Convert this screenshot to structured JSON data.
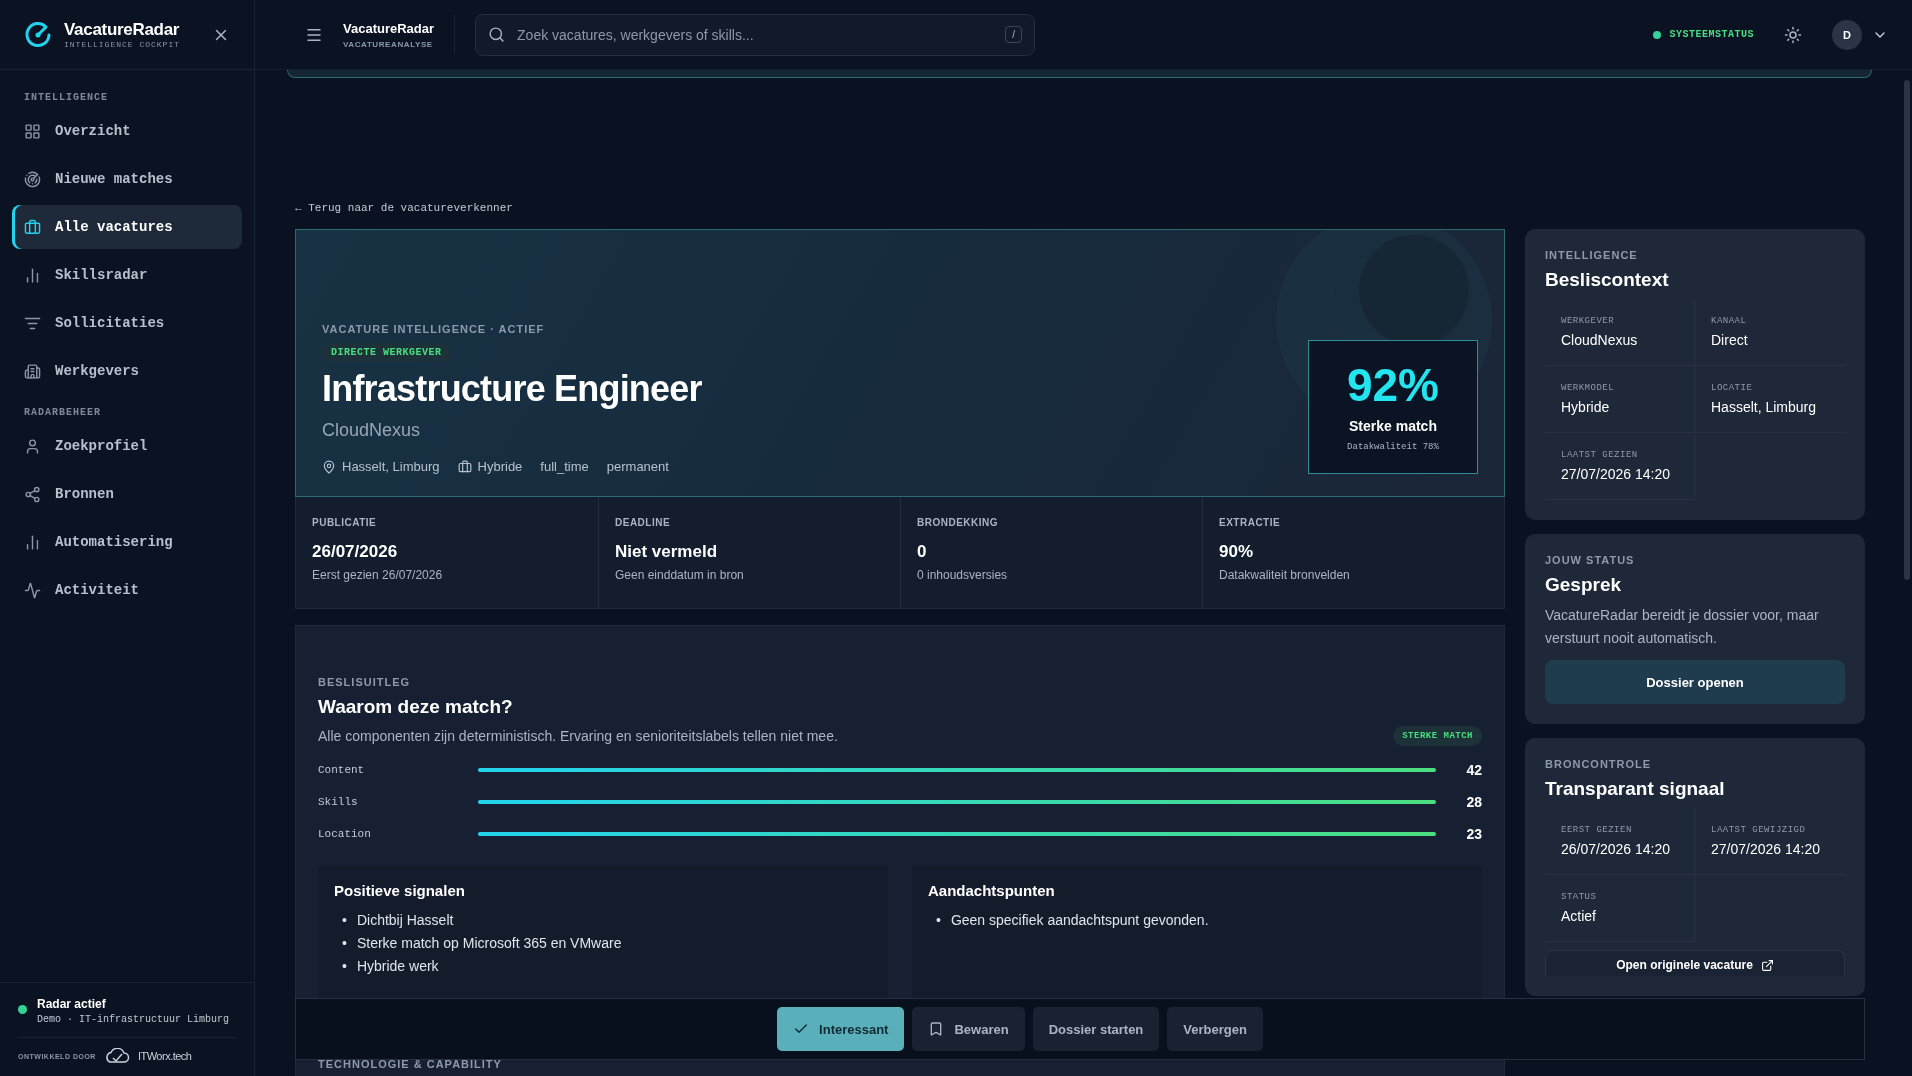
{
  "sidebar": {
    "brand": {
      "name": "VacatureRadar",
      "subtitle": "INTELLIGENCE COCKPIT"
    },
    "sections": [
      {
        "title": "INTELLIGENCE",
        "items": [
          {
            "label": "Overzicht",
            "selected": false
          },
          {
            "label": "Nieuwe matches",
            "selected": false
          },
          {
            "label": "Alle vacatures",
            "selected": true
          },
          {
            "label": "Skillsradar",
            "selected": false
          },
          {
            "label": "Sollicitaties",
            "selected": false
          },
          {
            "label": "Werkgevers",
            "selected": false
          }
        ]
      },
      {
        "title": "RADARBEHEER",
        "items": [
          {
            "label": "Zoekprofiel",
            "selected": false
          },
          {
            "label": "Bronnen",
            "selected": false
          },
          {
            "label": "Automatisering",
            "selected": false
          },
          {
            "label": "Activiteit",
            "selected": false
          }
        ]
      }
    ],
    "footer": {
      "status_title": "Radar actief",
      "status_detail": "Demo · IT-infrastructuur Limburg",
      "credit_label": "ONTWIKKELD DOOR",
      "credit_name": "ITWorx.tech"
    }
  },
  "topbar": {
    "title": "VacatureRadar",
    "subtitle": "VACATUREANALYSE",
    "search": {
      "placeholder": "Zoek vacatures, werkgevers of skills...",
      "shortcut": "/"
    },
    "status": "SYSTEEMSTATUS",
    "avatar": "D"
  },
  "back_link": "← Terug naar de vacatureverkenner",
  "hero": {
    "eyebrow": "VACATURE INTELLIGENCE · ACTIEF",
    "badge": "DIRECTE WERKGEVER",
    "title": "Infrastructure Engineer",
    "company": "CloudNexus",
    "meta": [
      {
        "kind": "location",
        "text": "Hasselt, Limburg"
      },
      {
        "kind": "work_model",
        "text": "Hybride"
      },
      {
        "kind": "plain",
        "text": "full_time"
      },
      {
        "kind": "plain",
        "text": "permanent"
      }
    ],
    "score": {
      "value": "92%",
      "label": "Sterke match",
      "quality": "Datakwaliteit 78%"
    }
  },
  "stats": [
    {
      "label": "PUBLICATIE",
      "value": "26/07/2026",
      "note": "Eerst gezien 26/07/2026"
    },
    {
      "label": "DEADLINE",
      "value": "Niet vermeld",
      "note": "Geen einddatum in bron"
    },
    {
      "label": "BRONDEKKING",
      "value": "0",
      "note": "0 inhoudsversies"
    },
    {
      "label": "EXTRACTIE",
      "value": "90%",
      "note": "Datakwaliteit bronvelden"
    }
  ],
  "explanation": {
    "eyebrow": "BESLISUITLEG",
    "title": "Waarom deze match?",
    "text": "Alle componenten zijn deterministisch. Ervaring en senioriteitslabels tellen niet mee.",
    "badge": "STERKE MATCH",
    "bars": [
      {
        "label": "Content",
        "level": 1,
        "value": "42"
      },
      {
        "label": "Skills",
        "level": 1,
        "value": "28"
      },
      {
        "label": "Location",
        "level": 1,
        "value": "23"
      }
    ],
    "positive": {
      "title": "Positieve signalen",
      "bullet": "•",
      "items": [
        "Dichtbij Hasselt",
        "Sterke match op Microsoft 365 en VMware",
        "Hybride werk"
      ]
    },
    "attention": {
      "title": "Aandachtspunten",
      "bullet": "•",
      "items": [
        "Geen specifiek aandachtspunt gevonden."
      ]
    }
  },
  "next_section": "TECHNOLOGIE & CAPABILITY",
  "context_card": {
    "eyebrow": "INTELLIGENCE",
    "title": "Besliscontext",
    "fields": [
      {
        "label": "WERKGEVER",
        "value": "CloudNexus"
      },
      {
        "label": "KANAAL",
        "value": "Direct"
      },
      {
        "label": "WERKMODEL",
        "value": "Hybride"
      },
      {
        "label": "LOCATIE",
        "value": "Hasselt, Limburg"
      },
      {
        "label": "LAATST GEZIEN",
        "value": "27/07/2026 14:20"
      }
    ]
  },
  "status_card": {
    "eyebrow": "JOUW STATUS",
    "title": "Gesprek",
    "text": "VacatureRadar bereidt je dossier voor, maar verstuurt nooit automatisch.",
    "button": "Dossier openen"
  },
  "source_card": {
    "eyebrow": "BRONCONTROLE",
    "title": "Transparant signaal",
    "fields": [
      {
        "label": "EERST GEZIEN",
        "value": "26/07/2026 14:20"
      },
      {
        "label": "LAATST GEWIJZIGD",
        "value": "27/07/2026 14:20"
      },
      {
        "label": "STATUS",
        "value": "Actief"
      }
    ],
    "link": "Open originele vacature"
  },
  "actions": [
    {
      "label": "Interessant",
      "selected": true
    },
    {
      "label": "Bewaren",
      "selected": false
    },
    {
      "label": "Dossier starten",
      "selected": false
    },
    {
      "label": "Verbergen",
      "selected": false
    }
  ]
}
